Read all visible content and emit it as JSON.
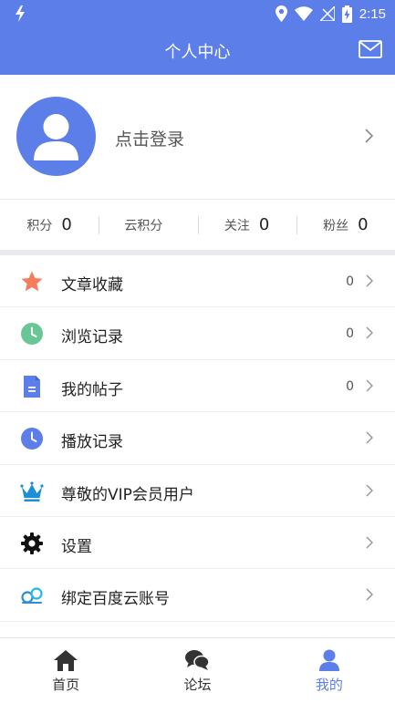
{
  "status_bar": {
    "time": "2:15"
  },
  "app_bar": {
    "title": "个人中心"
  },
  "profile": {
    "login_text": "点击登录"
  },
  "stats": [
    {
      "label": "积分",
      "value": "0"
    },
    {
      "label": "云积分",
      "value": ""
    },
    {
      "label": "关注",
      "value": "0"
    },
    {
      "label": "粉丝",
      "value": "0"
    }
  ],
  "menu": [
    {
      "label": "文章收藏",
      "count": "0",
      "icon": "star-icon",
      "color": "#f47d5c"
    },
    {
      "label": "浏览记录",
      "count": "0",
      "icon": "clock-icon",
      "color": "#68c795"
    },
    {
      "label": "我的帖子",
      "count": "0",
      "icon": "document-icon",
      "color": "#5b7ee8"
    },
    {
      "label": "播放记录",
      "count": "",
      "icon": "clock-icon",
      "color": "#5b7ee8"
    },
    {
      "label": "尊敬的VIP会员用户",
      "count": "",
      "icon": "crown-icon",
      "color": "#1c8fd6"
    },
    {
      "label": "设置",
      "count": "",
      "icon": "gear-icon",
      "color": "#111111"
    },
    {
      "label": "绑定百度云账号",
      "count": "",
      "icon": "cloud-link-icon",
      "color": "#2a8fd8"
    }
  ],
  "tabs": [
    {
      "label": "首页",
      "icon": "home-icon",
      "active": false
    },
    {
      "label": "论坛",
      "icon": "chat-bubbles-icon",
      "active": false
    },
    {
      "label": "我的",
      "icon": "person-icon",
      "active": true
    }
  ],
  "colors": {
    "primary": "#5b7ee8",
    "divider": "#eeeeee",
    "section_gap": "#e7e9ee"
  }
}
